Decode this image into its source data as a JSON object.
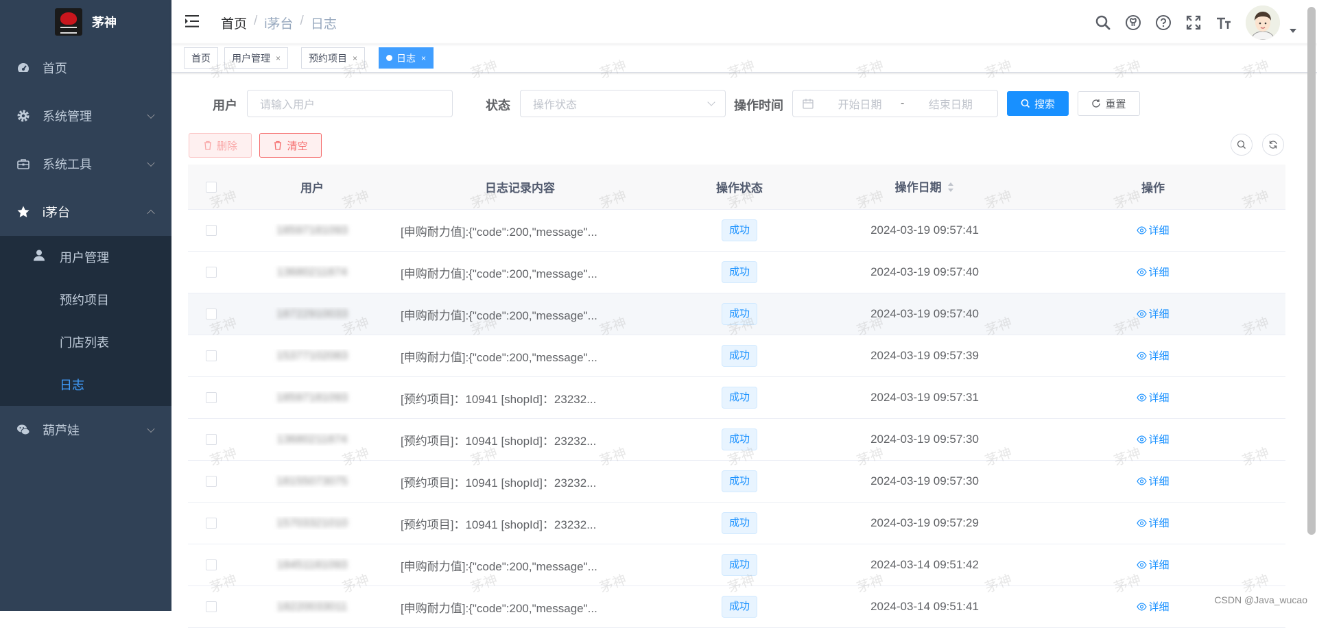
{
  "app": {
    "logo_title": "茅神"
  },
  "sidebar": {
    "items": [
      {
        "label": "首页",
        "icon": "dashboard-icon"
      },
      {
        "label": "系统管理",
        "icon": "gear-icon"
      },
      {
        "label": "系统工具",
        "icon": "toolbox-icon"
      },
      {
        "label": "i茅台",
        "icon": "star-icon"
      },
      {
        "label": "葫芦娃",
        "icon": "wechat-icon"
      }
    ],
    "submenu": [
      {
        "label": "用户管理",
        "icon": "user-icon"
      },
      {
        "label": "预约项目"
      },
      {
        "label": "门店列表"
      },
      {
        "label": "日志"
      }
    ]
  },
  "breadcrumb": {
    "home": "首页",
    "parent": "i茅台",
    "current": "日志",
    "sep": "/"
  },
  "tags": [
    {
      "label": "首页",
      "close": ""
    },
    {
      "label": "用户管理",
      "close": "×"
    },
    {
      "label": "预约项目",
      "close": "×"
    },
    {
      "label": "日志",
      "close": "×"
    }
  ],
  "search": {
    "user_label": "用户",
    "user_placeholder": "请输入用户",
    "status_label": "状态",
    "status_placeholder": "操作状态",
    "time_label": "操作时间",
    "start_placeholder": "开始日期",
    "range_sep": "-",
    "end_placeholder": "结束日期",
    "search_btn": "搜索",
    "reset_btn": "重置"
  },
  "toolbar": {
    "delete_btn": "删除",
    "clear_btn": "清空"
  },
  "table": {
    "headers": {
      "user": "用户",
      "content": "日志记录内容",
      "status": "操作状态",
      "date": "操作日期",
      "op": "操作"
    },
    "rows": [
      {
        "user": "18597181093",
        "content": "[申购耐力值]:{\"code\":200,\"message\"...",
        "status": "成功",
        "date": "2024-03-19 09:57:41",
        "op": "详细"
      },
      {
        "user": "13680211874",
        "content": "[申购耐力值]:{\"code\":200,\"message\"...",
        "status": "成功",
        "date": "2024-03-19 09:57:40",
        "op": "详细"
      },
      {
        "user": "18722910033",
        "content": "[申购耐力值]:{\"code\":200,\"message\"...",
        "status": "成功",
        "date": "2024-03-19 09:57:40",
        "op": "详细"
      },
      {
        "user": "15377102083",
        "content": "[申购耐力值]:{\"code\":200,\"message\"...",
        "status": "成功",
        "date": "2024-03-19 09:57:39",
        "op": "详细"
      },
      {
        "user": "18597181093",
        "content": "[预约项目]：10941 [shopId]：23232...",
        "status": "成功",
        "date": "2024-03-19 09:57:31",
        "op": "详细"
      },
      {
        "user": "13680211874",
        "content": "[预约项目]：10941 [shopId]：23232...",
        "status": "成功",
        "date": "2024-03-19 09:57:30",
        "op": "详细"
      },
      {
        "user": "18155073075",
        "content": "[预约项目]：10941 [shopId]：23232...",
        "status": "成功",
        "date": "2024-03-19 09:57:30",
        "op": "详细"
      },
      {
        "user": "15703321010",
        "content": "[预约项目]：10941 [shopId]：23232...",
        "status": "成功",
        "date": "2024-03-19 09:57:29",
        "op": "详细"
      },
      {
        "user": "18451181093",
        "content": "[申购耐力值]:{\"code\":200,\"message\"...",
        "status": "成功",
        "date": "2024-03-14 09:51:42",
        "op": "详细"
      },
      {
        "user": "18220033011",
        "content": "[申购耐力值]:{\"code\":200,\"message\"...",
        "status": "成功",
        "date": "2024-03-14 09:51:41",
        "op": "详细"
      }
    ]
  },
  "watermark": "茅神",
  "footer": {
    "csdn": "CSDN @Java_wucao"
  },
  "colors": {
    "sidebar": "#304156",
    "submenu": "#1f2d3d",
    "primary": "#1890ff",
    "active_menu": "#409eff",
    "danger": "#f56c6c"
  }
}
